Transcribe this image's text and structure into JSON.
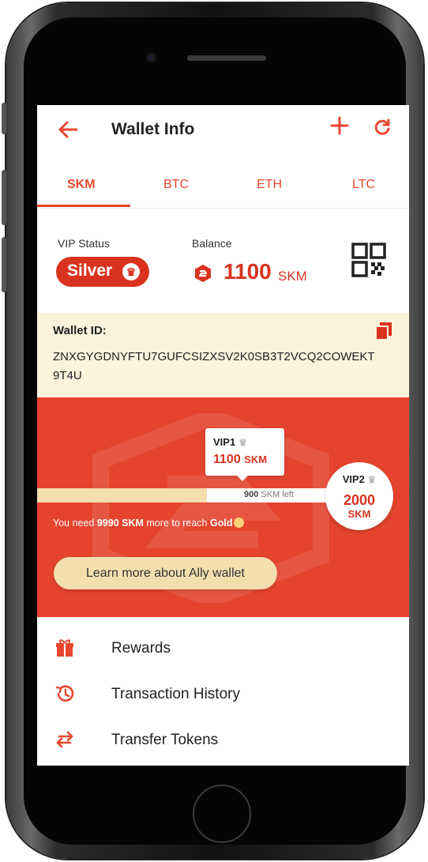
{
  "header": {
    "title": "Wallet Info"
  },
  "tabs": [
    {
      "label": "SKM",
      "active": true
    },
    {
      "label": "BTC",
      "active": false
    },
    {
      "label": "ETH",
      "active": false
    },
    {
      "label": "LTC",
      "active": false
    }
  ],
  "status": {
    "vip_label": "VIP Status",
    "tier": "Silver",
    "balance_label": "Balance",
    "balance_amount": "1100",
    "balance_unit": "SKM"
  },
  "wallet": {
    "id_label": "Wallet ID:",
    "id_value": "ZNXGYGDNYFTU7GUFCSIZXSV2K0SB3T2VCQ2COWEKT9T4U"
  },
  "vip_progress": {
    "current_level": "VIP1",
    "current_amount": "1100",
    "current_unit": "SKM",
    "remaining_amount": "900",
    "remaining_text": "SKM left",
    "next_level": "VIP2",
    "next_amount": "2000",
    "next_unit": "SKM",
    "progress_fraction": 0.55,
    "need_prefix": "You need ",
    "need_amount": "9990 SKM",
    "need_middle": " more to reach ",
    "need_target": "Gold",
    "learn_more": "Learn more about Ally wallet"
  },
  "menu": [
    {
      "label": "Rewards",
      "icon": "gift-icon"
    },
    {
      "label": "Transaction History",
      "icon": "history-icon"
    },
    {
      "label": "Transfer Tokens",
      "icon": "transfer-icon"
    }
  ],
  "colors": {
    "accent": "#e8472f",
    "banner": "#e4432d",
    "cream": "#fdf3dc",
    "gold_light": "#f3dfae"
  }
}
